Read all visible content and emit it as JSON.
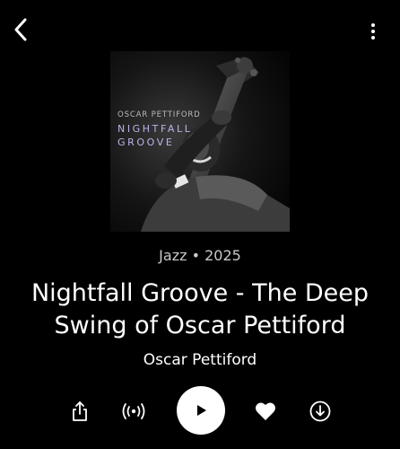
{
  "album": {
    "meta": "Jazz • 2025",
    "title": "Nightfall Groove - The Deep Swing of Oscar Pettiford",
    "artist": "Oscar Pettiford"
  },
  "cover": {
    "artist_text": "OSCAR PETTIFORD",
    "title_line1": "NIGHTFALL",
    "title_line2": "GROOVE"
  },
  "icons": {
    "back": "chevron-left-icon",
    "more": "vertical-dots-icon",
    "share": "share-icon",
    "radio": "radio-broadcast-icon",
    "play": "play-icon",
    "like": "heart-icon",
    "download": "download-icon"
  },
  "colors": {
    "background": "#000000",
    "play_button": "#ffffff",
    "cover_title": "#b9b4ea"
  }
}
